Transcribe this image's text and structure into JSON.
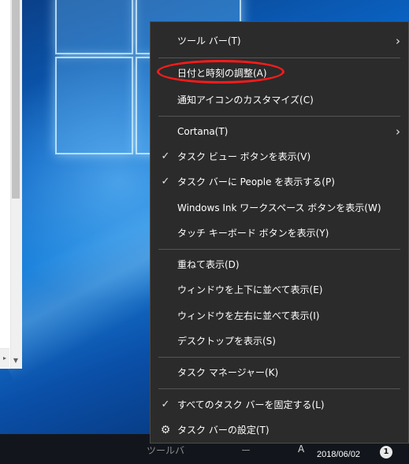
{
  "menu": {
    "items": [
      {
        "label": "ツール バー(T)",
        "submenu": true,
        "checked": false
      },
      {
        "label": "日付と時刻の調整(A)",
        "submenu": false,
        "checked": false,
        "highlighted": true
      },
      {
        "label": "通知アイコンのカスタマイズ(C)",
        "submenu": false,
        "checked": false
      },
      {
        "label": "Cortana(T)",
        "submenu": true,
        "checked": false
      },
      {
        "label": "タスク ビュー ボタンを表示(V)",
        "submenu": false,
        "checked": true
      },
      {
        "label": "タスク バーに People を表示する(P)",
        "submenu": false,
        "checked": true
      },
      {
        "label": "Windows Ink ワークスペース ボタンを表示(W)",
        "submenu": false,
        "checked": false
      },
      {
        "label": "タッチ キーボード ボタンを表示(Y)",
        "submenu": false,
        "checked": false
      },
      {
        "label": "重ねて表示(D)",
        "submenu": false,
        "checked": false
      },
      {
        "label": "ウィンドウを上下に並べて表示(E)",
        "submenu": false,
        "checked": false
      },
      {
        "label": "ウィンドウを左右に並べて表示(I)",
        "submenu": false,
        "checked": false
      },
      {
        "label": "デスクトップを表示(S)",
        "submenu": false,
        "checked": false
      },
      {
        "label": "タスク マネージャー(K)",
        "submenu": false,
        "checked": false
      },
      {
        "label": "すべてのタスク バーを固定する(L)",
        "submenu": false,
        "checked": true
      },
      {
        "label": "タスク バーの設定(T)",
        "submenu": false,
        "checked": false,
        "icon": "gear-icon"
      }
    ],
    "check_glyph": "✓",
    "arrow_glyph": "›",
    "gear_glyph": "⚙"
  },
  "taskbar": {
    "partial_left": "ツールバ",
    "partial_mid": "ー",
    "partial_ime": "A",
    "date": "2018/06/02",
    "notification_count": "1"
  },
  "colors": {
    "menu_bg": "#2b2b2b",
    "annotation_ring": "#ff1a1a",
    "taskbar_bg": "#12161c"
  }
}
